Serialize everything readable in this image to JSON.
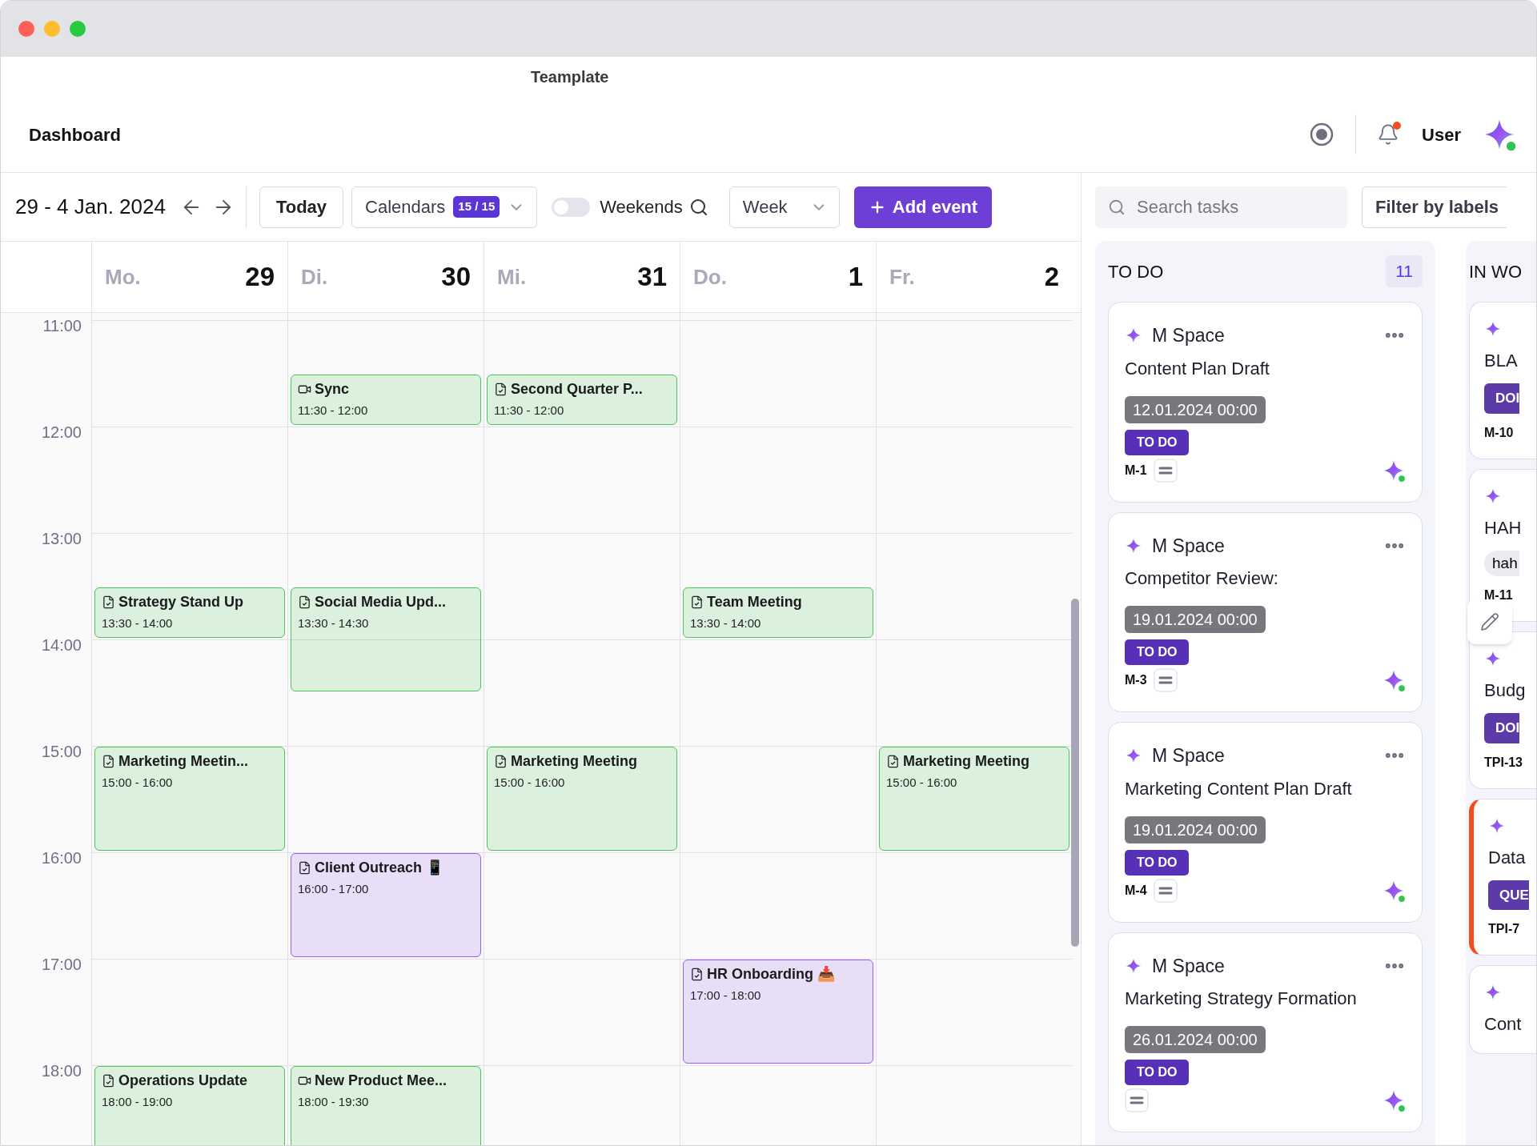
{
  "window": {
    "title": "Teamplate"
  },
  "header": {
    "title": "Dashboard",
    "user": "User"
  },
  "toolbar": {
    "date_range": "29 - 4 Jan. 2024",
    "today": "Today",
    "calendars": {
      "label": "Calendars",
      "count": "15 / 15"
    },
    "weekends": {
      "label": "Weekends",
      "on": false
    },
    "view": "Week",
    "add_event": "Add event"
  },
  "hours": [
    "11:00",
    "12:00",
    "13:00",
    "14:00",
    "15:00",
    "16:00",
    "17:00",
    "18:00"
  ],
  "days": [
    {
      "weekday": "Mo.",
      "date": "29",
      "events": [
        {
          "title": "Strategy Stand Up",
          "time": "13:30 - 14:00",
          "kind": "task",
          "color": "#4cc35a"
        },
        {
          "title": "Marketing Meetin...",
          "time": "15:00 - 16:00",
          "kind": "task",
          "color": "#4cc35a"
        },
        {
          "title": "Operations Update",
          "time": "18:00 - 19:00",
          "kind": "task",
          "color": "#4cc35a"
        }
      ]
    },
    {
      "weekday": "Di.",
      "date": "30",
      "events": [
        {
          "title": "Sync",
          "time": "11:30 - 12:00",
          "kind": "video",
          "color": "#4cc35a"
        },
        {
          "title": "Social Media Upd...",
          "time": "13:30 - 14:30",
          "kind": "task",
          "color": "#4cc35a"
        },
        {
          "title": "Client Outreach 📱",
          "time": "16:00 - 17:00",
          "kind": "task",
          "color": "#9b5cf0"
        },
        {
          "title": "New Product Mee...",
          "time": "18:00 - 19:30",
          "kind": "video",
          "color": "#4cc35a"
        }
      ]
    },
    {
      "weekday": "Mi.",
      "date": "31",
      "events": [
        {
          "title": "Second Quarter P...",
          "time": "11:30 - 12:00",
          "kind": "task",
          "color": "#4cc35a"
        },
        {
          "title": "Marketing Meeting",
          "time": "15:00 - 16:00",
          "kind": "task",
          "color": "#4cc35a"
        }
      ]
    },
    {
      "weekday": "Do.",
      "date": "1",
      "events": [
        {
          "title": "Team Meeting",
          "time": "13:30 - 14:00",
          "kind": "task",
          "color": "#4cc35a"
        },
        {
          "title": "HR Onboarding 📥",
          "time": "17:00 - 18:00",
          "kind": "task",
          "color": "#9b5cf0"
        }
      ]
    },
    {
      "weekday": "Fr.",
      "date": "2",
      "events": [
        {
          "title": "Marketing Meeting",
          "time": "15:00 - 16:00",
          "kind": "task",
          "color": "#4cc35a"
        }
      ]
    }
  ],
  "tasks": {
    "search": {
      "placeholder": "Search tasks"
    },
    "filter": "Filter by labels",
    "columns": [
      {
        "title": "TO DO",
        "count": "11",
        "cards": [
          {
            "project": "M Space",
            "title": "Content Plan Draft",
            "due": "12.01.2024 00:00",
            "status": "TO DO",
            "key": "M-1"
          },
          {
            "project": "M Space",
            "title": "Competitor Review:",
            "due": "19.01.2024 00:00",
            "status": "TO DO",
            "key": "M-3"
          },
          {
            "project": "M Space",
            "title": "Marketing Content Plan Draft",
            "due": "19.01.2024 00:00",
            "status": "TO DO",
            "key": "M-4"
          },
          {
            "project": "M Space",
            "title": "Marketing Strategy Formation",
            "due": "26.01.2024 00:00",
            "status": "TO DO"
          }
        ]
      },
      {
        "title": "IN WO",
        "cards": [
          {
            "title": "BLA",
            "status": "DOI",
            "key": "M-10"
          },
          {
            "title": "HAH",
            "tag": "hah",
            "key": "M-11"
          },
          {
            "title": "Budg",
            "status": "DOI",
            "key": "TPI-13"
          },
          {
            "title": "Data",
            "status": "QUE",
            "key": "TPI-7",
            "color": "#f04e23"
          },
          {
            "title": "Cont"
          }
        ]
      }
    ]
  }
}
